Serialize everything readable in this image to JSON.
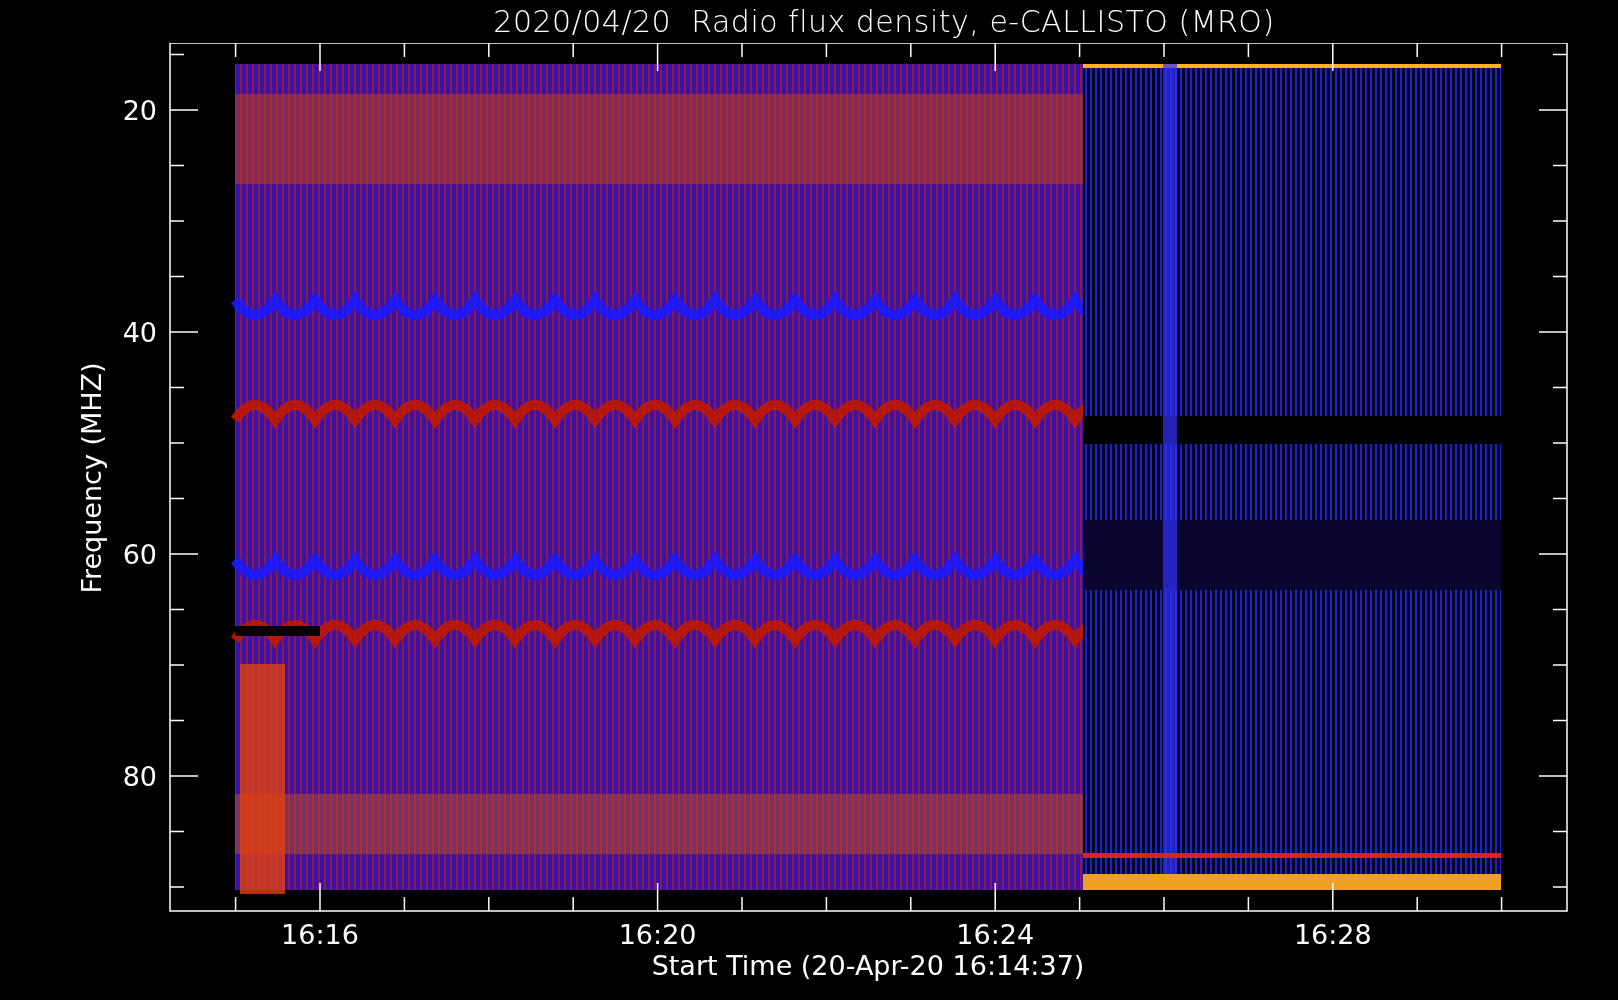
{
  "title": "2020/04/20  Radio flux density, e-CALLISTO (MRO)",
  "y_axis": {
    "label": "Frequency (MHZ)",
    "ticks": [
      "20",
      "40",
      "60",
      "80"
    ]
  },
  "x_axis": {
    "label": "Start Time (20-Apr-20 16:14:37)",
    "ticks": [
      "16:16",
      "16:20",
      "16:24",
      "16:28"
    ]
  }
}
